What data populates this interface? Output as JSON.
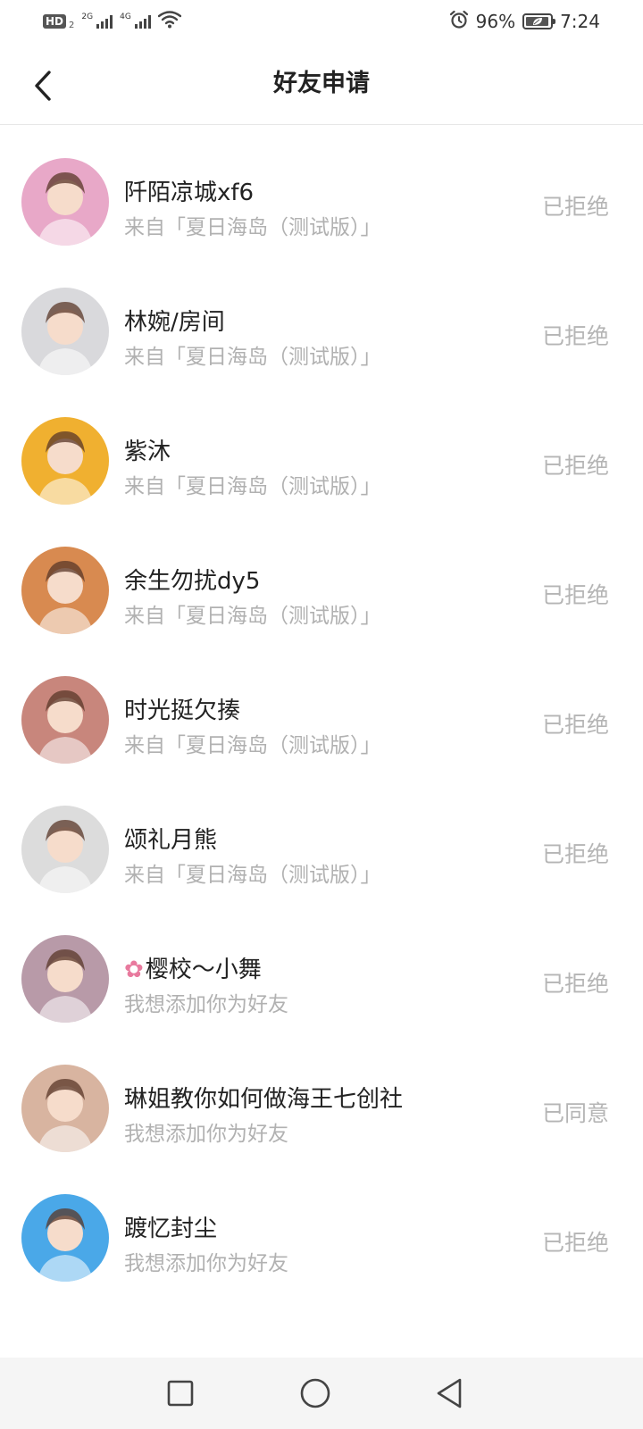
{
  "status_bar": {
    "hd_label": "HD",
    "sim_number": "2",
    "network_1": "2G",
    "network_2": "4G",
    "battery_percent": "96%",
    "time": "7:24",
    "battery_level": 0.96
  },
  "header": {
    "title": "好友申请",
    "back_icon": "chevron-left-icon"
  },
  "requests": [
    {
      "name": "阡陌凉城xf6",
      "source": "来自「夏日海岛（测试版）」",
      "status": "已拒绝",
      "avatar_bg": "#e8a8c8"
    },
    {
      "name": "林婉/房间",
      "source": "来自「夏日海岛（测试版）」",
      "status": "已拒绝",
      "avatar_bg": "#d9d9dc"
    },
    {
      "name": "紫沐",
      "source": "来自「夏日海岛（测试版）」",
      "status": "已拒绝",
      "avatar_bg": "#f0b030"
    },
    {
      "name": "余生勿扰dy5",
      "source": "来自「夏日海岛（测试版）」",
      "status": "已拒绝",
      "avatar_bg": "#d88a50"
    },
    {
      "name": "时光挺欠揍",
      "source": "来自「夏日海岛（测试版）」",
      "status": "已拒绝",
      "avatar_bg": "#c8867c"
    },
    {
      "name": "颂礼月熊",
      "source": "来自「夏日海岛（测试版）」",
      "status": "已拒绝",
      "avatar_bg": "#dcdcdc"
    },
    {
      "name": "樱校～小舞",
      "source": "我想添加你为好友",
      "status": "已拒绝",
      "avatar_bg": "#b89aa8",
      "prefix_icon": "cherry-blossom-icon"
    },
    {
      "name": "琳姐教你如何做海王七创社",
      "source": "我想添加你为好友",
      "status": "已同意",
      "avatar_bg": "#d8b4a0"
    },
    {
      "name": "踱忆封尘",
      "source": "我想添加你为好友",
      "status": "已拒绝",
      "avatar_bg": "#4aa8e8"
    }
  ],
  "nav_bar": {
    "recent_icon": "square-icon",
    "home_icon": "circle-icon",
    "back_icon": "triangle-back-icon"
  },
  "colors": {
    "text_primary": "#222222",
    "text_secondary": "#b1b1b1",
    "divider": "#e6e6e6",
    "nav_bg": "#f5f5f5"
  }
}
